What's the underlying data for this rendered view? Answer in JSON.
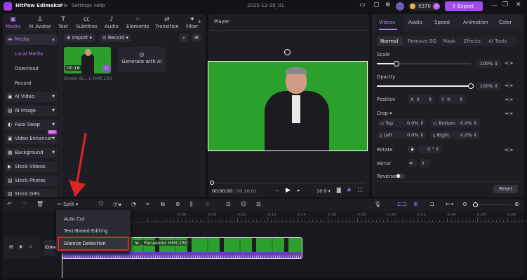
{
  "app": {
    "title": "HitPaw Edimakor",
    "menu": [
      "File",
      "Settings",
      "Help"
    ],
    "project": "2025-12-30_01",
    "credits": "9370",
    "export_label": "Export",
    "accent": "#a24cf0"
  },
  "top_tabs": [
    {
      "label": "Media",
      "icon": "media-icon"
    },
    {
      "label": "AI Avatar",
      "icon": "avatar-icon"
    },
    {
      "label": "Text",
      "icon": "text-icon"
    },
    {
      "label": "Subtitles",
      "icon": "subtitles-icon"
    },
    {
      "label": "Audio",
      "icon": "audio-icon"
    },
    {
      "label": "Elements",
      "icon": "elements-icon"
    },
    {
      "label": "Transition",
      "icon": "transition-icon"
    },
    {
      "label": "Filters",
      "icon": "filters-icon"
    }
  ],
  "sidebar": {
    "media": "Media",
    "sub": [
      "Local Media",
      "Download",
      "Record"
    ],
    "items": [
      {
        "label": "AI Video"
      },
      {
        "label": "AI Image"
      },
      {
        "label": "Face Swap"
      },
      {
        "label": "Video Enhancer",
        "badge": "NEW"
      },
      {
        "label": "Background"
      },
      {
        "label": "Stock Videos"
      },
      {
        "label": "Stock Photos"
      },
      {
        "label": "Stock GIFs"
      }
    ]
  },
  "media": {
    "import_label": "Import",
    "record_label": "Record",
    "clip_duration": "00:16",
    "clip_name": "Green Sc...c HMC150",
    "generate_label": "Generate with AI"
  },
  "player": {
    "title": "Player",
    "current_time": "00:00:00",
    "total_time": "00:16:01",
    "aspect": "16:9",
    "progress": 0
  },
  "inspector": {
    "tabs": [
      "Videos",
      "Audio",
      "Speed",
      "Animation",
      "Color"
    ],
    "subtabs": [
      "Normal",
      "Remove BG",
      "Mask",
      "Effects",
      "AI Tools"
    ],
    "scale_label": "Scale",
    "scale_value": "100%",
    "scale_fraction": 0.21,
    "opacity_label": "Opacity",
    "opacity_value": "100%",
    "opacity_fraction": 1.0,
    "position_label": "Position",
    "x_label": "X",
    "x_value": "0",
    "y_label": "Y",
    "y_value": "0",
    "crop_label": "Crop",
    "top_label": "Top",
    "top_value": "0.0%",
    "bottom_label": "Bottom",
    "bottom_value": "0.0%",
    "left_label": "Left",
    "left_value": "0.0%",
    "right_label": "Right",
    "right_value": "0.0%",
    "rotate_label": "Rotate",
    "rotate_value": "0",
    "mirror_label": "Mirror",
    "reverse_label": "Reverse",
    "reverse_on": false,
    "reset_label": "Reset"
  },
  "timeline": {
    "split_label": "Split",
    "ticks": [
      "0:06",
      "0:08",
      "0:10",
      "0:12",
      "0:14",
      "0:16",
      "0:18",
      "0:20",
      "0:22",
      "0:24",
      "0:26",
      "0:28",
      "0:30"
    ],
    "cover_label": "Cover",
    "clip_label": "le _ Panasonic HMC150"
  },
  "split_menu": {
    "items": [
      "Auto Cut",
      "Text-Based Editing",
      "Silence Detection"
    ],
    "highlighted": "Silence Detection",
    "highlight_color": "#e02424"
  }
}
